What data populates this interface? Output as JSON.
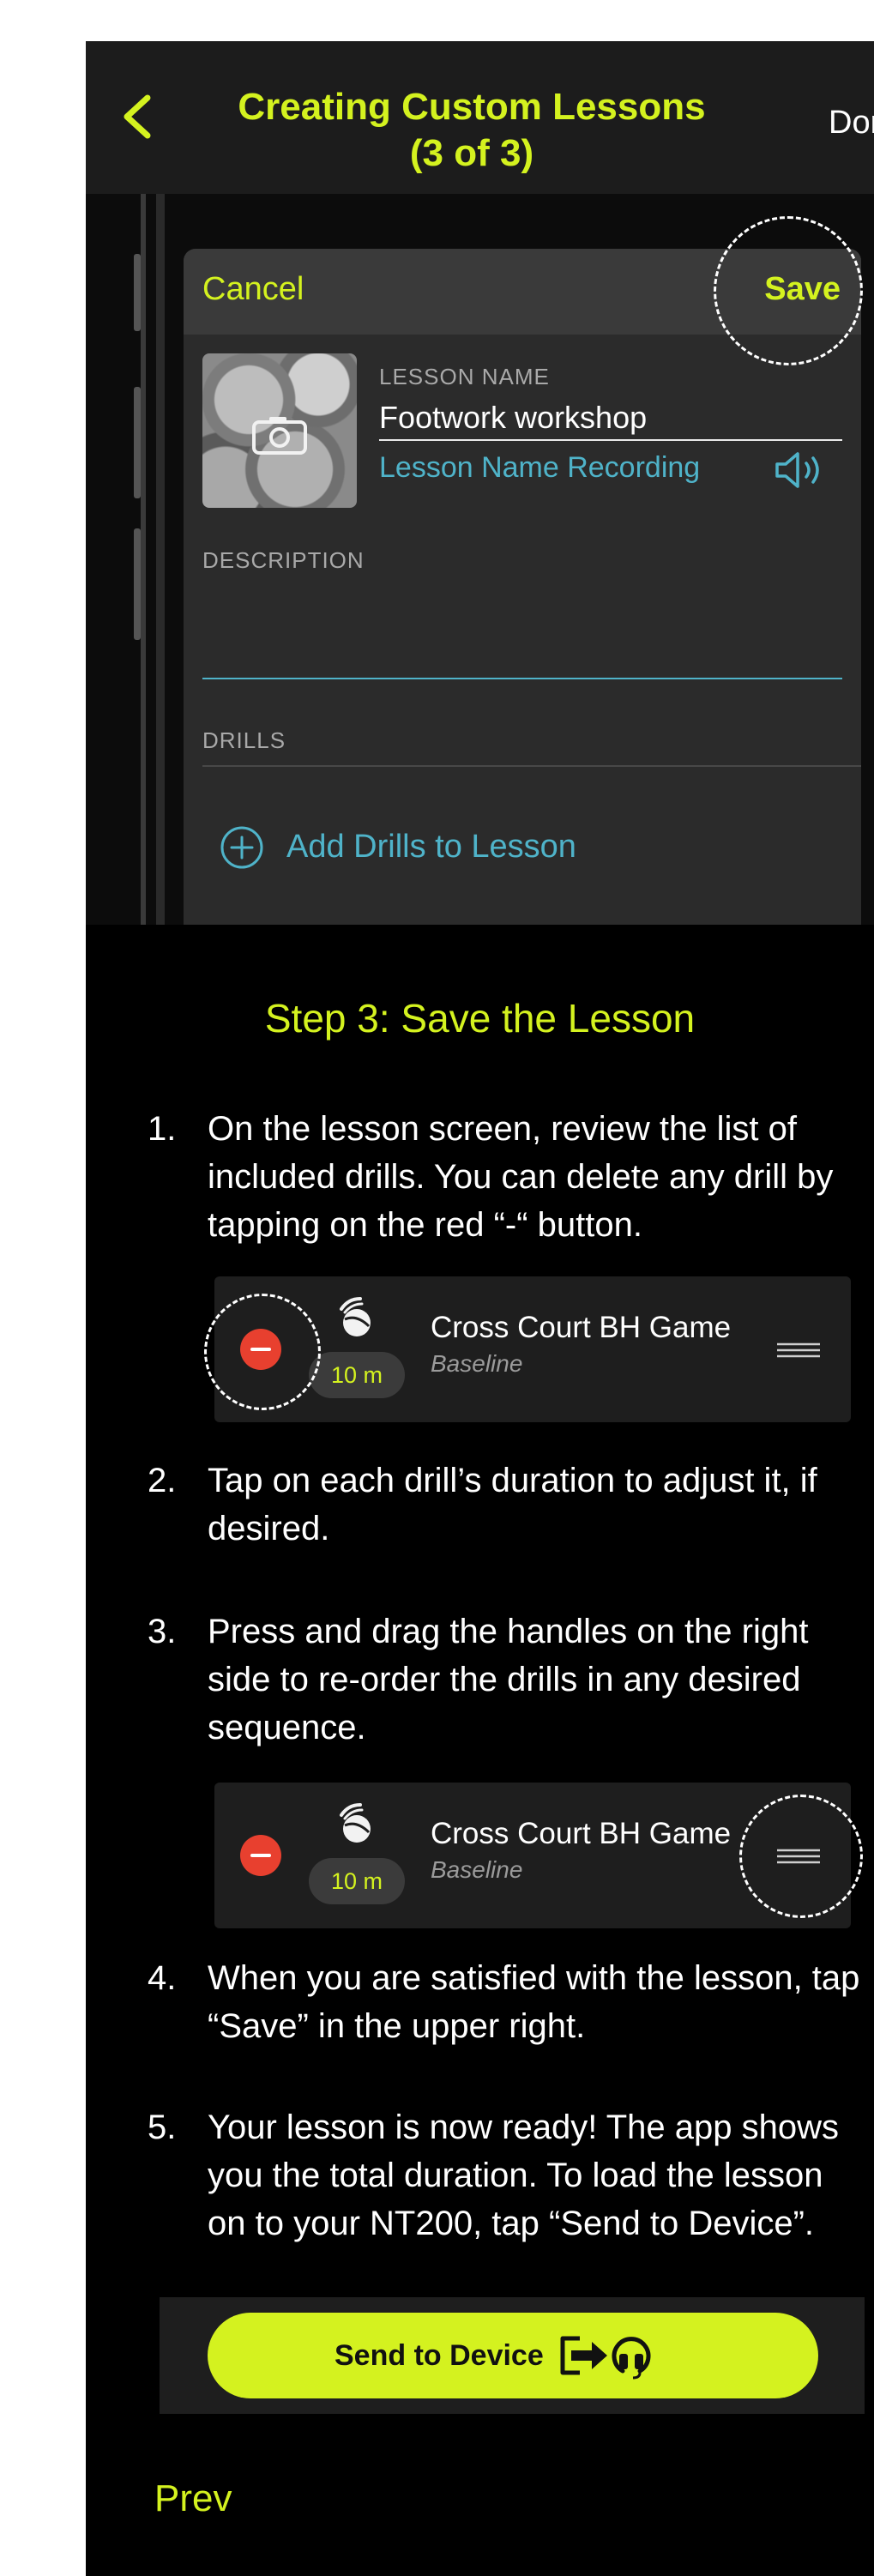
{
  "header": {
    "title": "Creating Custom Lessons (3 of 3)",
    "done_label": "Done"
  },
  "screenshot": {
    "cancel_label": "Cancel",
    "save_label": "Save",
    "lesson_name_label": "LESSON NAME",
    "lesson_name_value": "Footwork workshop",
    "recording_label": "Lesson Name Recording",
    "description_label": "DESCRIPTION",
    "drills_label": "DRILLS",
    "add_drills_label": "Add Drills to Lesson"
  },
  "content": {
    "step_title": "Step 3: Save the Lesson",
    "steps": [
      {
        "num": "1.",
        "text": "On the lesson screen, review the list of included drills. You can delete any drill by tapping on the red “-“ button."
      },
      {
        "num": "2.",
        "text": "Tap on each drill’s duration to adjust it, if desired."
      },
      {
        "num": "3.",
        "text": "Press and drag the handles on the right side to re-order the drills in any desired sequence."
      },
      {
        "num": "4.",
        "text": "When you are satisfied with the lesson, tap “Save” in the upper right."
      },
      {
        "num": "5.",
        "text": "Your lesson is now ready! The app shows you the total duration. To load the lesson on to your NT200, tap “Send to Device”."
      }
    ],
    "drill": {
      "name": "Cross Court BH Game",
      "category": "Baseline",
      "duration": "10 m"
    },
    "send_button_label": "Send to Device",
    "prev_label": "Prev"
  },
  "colors": {
    "accent": "#d4f21f",
    "link": "#4fb3c9",
    "delete": "#e8402f"
  },
  "icons": [
    "chevron-left-icon",
    "camera-icon",
    "speaker-icon",
    "plus-circle-icon",
    "tennis-ball-icon",
    "minus-icon",
    "drag-handle-icon",
    "send-to-device-icon"
  ]
}
